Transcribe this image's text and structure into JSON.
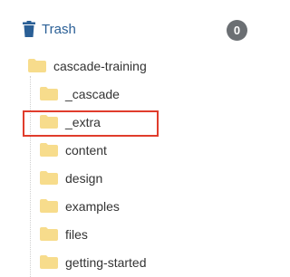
{
  "trash": {
    "label": "Trash",
    "count": "0",
    "icon": "trash-icon"
  },
  "tree": {
    "root": {
      "label": "cascade-training",
      "icon": "folder-icon"
    },
    "children": [
      {
        "label": "_cascade",
        "icon": "folder-icon"
      },
      {
        "label": "_extra",
        "icon": "folder-icon",
        "highlighted": true
      },
      {
        "label": "content",
        "icon": "folder-icon"
      },
      {
        "label": "design",
        "icon": "folder-icon"
      },
      {
        "label": "examples",
        "icon": "folder-icon"
      },
      {
        "label": "files",
        "icon": "folder-icon"
      },
      {
        "label": "getting-started",
        "icon": "folder-icon"
      }
    ]
  },
  "colors": {
    "link": "#2a5f96",
    "badge": "#6b6f73",
    "folder": "#f7dc8c",
    "highlight_border": "#e03c2c"
  }
}
